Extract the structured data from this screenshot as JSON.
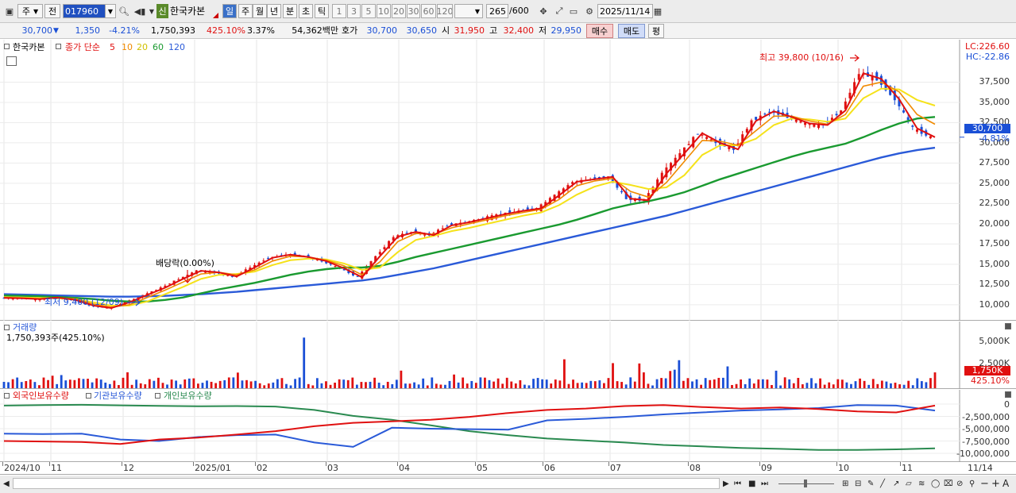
{
  "toolbar": {
    "type_label": "주",
    "prev_label": "전",
    "code_value": "017960",
    "badge_label": "신",
    "stock_name": "한국카본",
    "periods": [
      "일",
      "주",
      "월",
      "년",
      "분",
      "초",
      "틱"
    ],
    "minute_options": [
      "1",
      "3",
      "5",
      "10",
      "20",
      "30",
      "60",
      "120"
    ],
    "count_value": "265",
    "count_total": "/600",
    "date_value": "2025/11/14"
  },
  "quote": {
    "price": "30,700",
    "change_arrow": "▼",
    "change": "1,350",
    "change_pct": "-4.21%",
    "volume": "1,750,393",
    "volume_pct": "425.10%",
    "turnover": "3.37%",
    "amount": "54,362백만",
    "hoga_label": "호가",
    "ask": "30,700",
    "bid": "30,650",
    "open_label": "시",
    "open": "31,950",
    "high_label": "고",
    "high": "32,400",
    "low_label": "저",
    "low": "29,950",
    "buy_label": "매수",
    "sell_label": "매도",
    "eval_label": "평"
  },
  "colors": {
    "ma5": "#e01010",
    "ma10": "#f08a00",
    "ma20": "#f5e21a",
    "ma60": "#1a9a30",
    "ma120": "#2a5ad8",
    "up": "#e01010",
    "down": "#1a4fd6",
    "foreign": "#e01010",
    "inst": "#2a5ad8",
    "retail": "#2a8a50"
  },
  "price_panel": {
    "name": "한국카본",
    "legend_label": "종가 단순",
    "ma_labels": [
      "5",
      "10",
      "20",
      "60",
      "120"
    ],
    "lc": "LC:226.60",
    "hc": "HC:-22.86",
    "axis_labels": [
      "37,500",
      "35,000",
      "32,500",
      "30,000",
      "27,500",
      "25,000",
      "22,500",
      "20,000",
      "17,500",
      "15,000",
      "12,500",
      "10,000"
    ],
    "axis_values": [
      37500,
      35000,
      32500,
      30000,
      27500,
      25000,
      22500,
      20000,
      17500,
      15000,
      12500,
      10000
    ],
    "current_badge": "30,700",
    "current_pct": "-4.81%",
    "high_annotation": "최고 39,800 (10/16)",
    "low_annotation": "최저 9,400 (12/09)",
    "dividend_annotation": "배당락(0.00%)"
  },
  "volume_panel": {
    "title": "거래량",
    "summary": "1,750,393주(425.10%)",
    "axis_labels": [
      "5,000K",
      "2,500K"
    ],
    "current_badge": "1,750K",
    "current_pct": "425.10%"
  },
  "holding_panel": {
    "legend": [
      "외국인보유수량",
      "기관보유수량",
      "개인보유수량"
    ],
    "axis_labels": [
      "0",
      "-2,500,000",
      "-5,000,000",
      "-7,500,000",
      "-10,000,000"
    ],
    "axis_values": [
      0,
      -2500000,
      -5000000,
      -7500000,
      -10000000
    ]
  },
  "x_axis": {
    "labels": [
      "2024/10",
      "11",
      "12",
      "2025/01",
      "02",
      "03",
      "04",
      "05",
      "06",
      "07",
      "08",
      "09",
      "10",
      "11"
    ],
    "end_label": "11/14"
  },
  "chart_data": {
    "type": "candlestick",
    "series": [
      {
        "name": "종가 단순 5",
        "values": [
          10850,
          10800,
          10700,
          10900,
          10600,
          9900,
          9600,
          10300,
          11200,
          12100,
          13200,
          14200,
          14000,
          13500,
          14600,
          15800,
          16200,
          15900,
          15400,
          14500,
          13400,
          16000,
          18400,
          19000,
          18600,
          19800,
          20200,
          20700,
          21200,
          21600,
          21900,
          23500,
          25200,
          25500,
          25800,
          23100,
          22900,
          26200,
          28700,
          31200,
          30000,
          29200,
          32700,
          33900,
          33200,
          32400,
          32200,
          34000,
          38600,
          37900,
          35400,
          31800,
          30700
        ]
      },
      {
        "name": "10",
        "values": [
          10900,
          10850,
          10750,
          10850,
          10700,
          10100,
          9700,
          10000,
          10900,
          11800,
          12800,
          13800,
          14000,
          13700,
          14300,
          15400,
          16000,
          15900,
          15500,
          14800,
          13700,
          15300,
          17800,
          18800,
          18700,
          19500,
          20000,
          20500,
          21000,
          21400,
          21800,
          23000,
          24700,
          25300,
          25600,
          24000,
          23300,
          25100,
          27700,
          30300,
          30200,
          29700,
          31500,
          33300,
          33300,
          32700,
          32300,
          33500,
          37000,
          37500,
          36300,
          33500,
          32300
        ]
      },
      {
        "name": "20",
        "values": [
          10950,
          10900,
          10850,
          10800,
          10700,
          10300,
          9900,
          9900,
          10400,
          11300,
          12200,
          13200,
          13700,
          13800,
          14100,
          14900,
          15500,
          15700,
          15600,
          15100,
          14300,
          14600,
          16500,
          18000,
          18500,
          19100,
          19500,
          20000,
          20500,
          21000,
          21400,
          22300,
          23600,
          24600,
          25200,
          24800,
          24300,
          24500,
          26000,
          28500,
          29700,
          29700,
          30500,
          32200,
          33000,
          32900,
          32600,
          33000,
          35500,
          36700,
          36600,
          35300,
          34600
        ]
      },
      {
        "name": "60",
        "values": [
          11150,
          11100,
          11050,
          10950,
          10850,
          10700,
          10500,
          10400,
          10400,
          10600,
          10900,
          11400,
          11900,
          12300,
          12700,
          13200,
          13700,
          14100,
          14400,
          14600,
          14600,
          14800,
          15300,
          15900,
          16400,
          16900,
          17400,
          17900,
          18400,
          18900,
          19400,
          19900,
          20500,
          21200,
          21900,
          22400,
          22800,
          23300,
          23900,
          24700,
          25500,
          26200,
          26900,
          27600,
          28300,
          28900,
          29400,
          29900,
          30700,
          31600,
          32400,
          33000,
          33200
        ]
      },
      {
        "name": "120",
        "values": [
          11300,
          11250,
          11200,
          11150,
          11100,
          11050,
          11000,
          11000,
          11050,
          11100,
          11200,
          11300,
          11450,
          11600,
          11800,
          12000,
          12200,
          12400,
          12600,
          12800,
          13000,
          13300,
          13700,
          14100,
          14500,
          15000,
          15500,
          16000,
          16500,
          17000,
          17500,
          18000,
          18500,
          19000,
          19500,
          20000,
          20500,
          21000,
          21600,
          22200,
          22800,
          23400,
          24000,
          24600,
          25200,
          25800,
          26400,
          27000,
          27600,
          28200,
          28700,
          29100,
          29400
        ]
      }
    ],
    "annotations": {
      "high": 39800,
      "high_date": "10/16",
      "low": 9400,
      "low_date": "12/09"
    },
    "ylim": [
      9400,
      39800
    ],
    "volume_ylim": [
      0,
      6500000
    ]
  }
}
